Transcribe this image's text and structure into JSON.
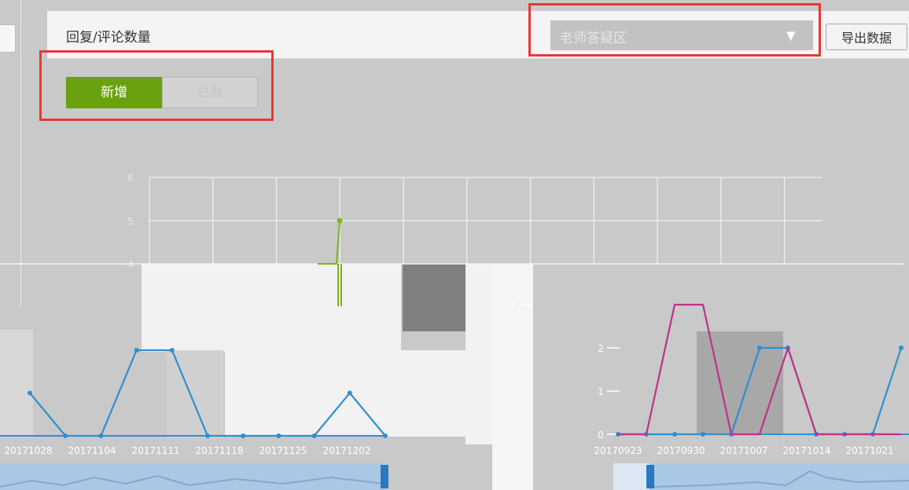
{
  "header": {
    "title": "回复/评论数量",
    "select_value": "老师答疑区",
    "export_label": "导出数据"
  },
  "toggle": {
    "new_label": "新增",
    "total_label": "总数",
    "active": "新增"
  },
  "colors": {
    "accent_green": "#6aa10f",
    "highlight_red": "#e53935",
    "series_blue": "#2f8fd0",
    "series_magenta": "#c0308a",
    "series_green": "#7fb31c"
  },
  "icons": {
    "select_arrow": "chevron-down-icon"
  },
  "chart_data": [
    {
      "type": "line",
      "y_ticks": [
        "6",
        "5",
        "4"
      ],
      "series": [
        {
          "x_index": [
            0,
            1,
            2,
            3,
            4,
            5,
            6,
            7
          ],
          "values": [
            4,
            4,
            4,
            4,
            4,
            4,
            4,
            5
          ]
        }
      ],
      "ylim": [
        4,
        6
      ]
    },
    {
      "type": "line",
      "categories": [
        "20171028",
        "20171104",
        "20171111",
        "20171118",
        "20171125",
        "20171202"
      ],
      "series": [
        {
          "values": [
            1,
            0,
            0,
            2,
            2,
            0,
            0,
            0,
            0,
            1,
            0
          ]
        }
      ],
      "ylim": [
        0,
        2
      ]
    },
    {
      "type": "line",
      "categories": [
        "20170923",
        "20170930",
        "20171007",
        "20171014",
        "20171021"
      ],
      "y_ticks": [
        "0",
        "1",
        "2",
        "3"
      ],
      "series": [
        {
          "values": [
            0,
            0,
            0,
            0,
            0,
            2,
            2,
            0,
            0,
            0,
            2
          ]
        },
        {
          "values": [
            0,
            0,
            3,
            3,
            0,
            0,
            2,
            0,
            0,
            0,
            0
          ]
        }
      ],
      "ylim": [
        0,
        3
      ]
    }
  ]
}
